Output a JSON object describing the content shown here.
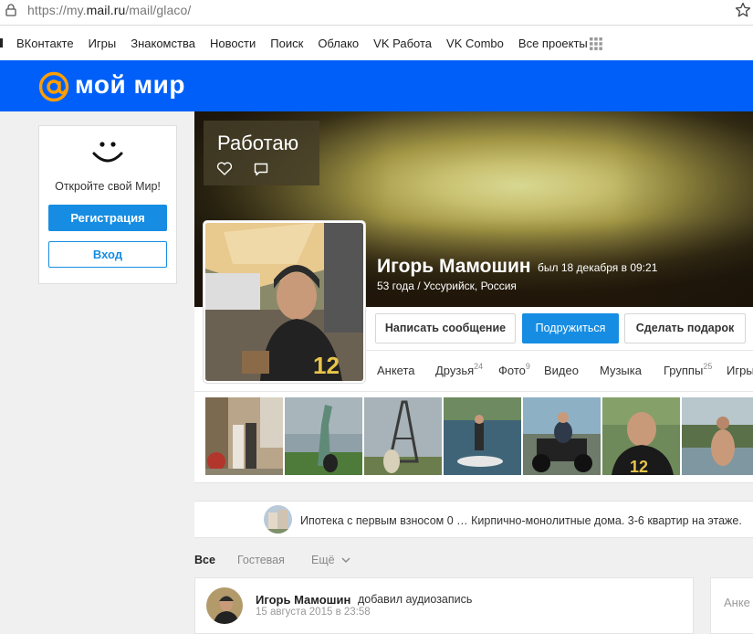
{
  "browser": {
    "url_prefix": "https://my.",
    "url_domain": "mail.ru",
    "url_path": "/mail/glaco/"
  },
  "portal_nav": {
    "items": [
      "ВКонтакте",
      "Игры",
      "Знакомства",
      "Новости",
      "Поиск",
      "Облако",
      "VK Работа",
      "VK Combo",
      "Все проекты"
    ]
  },
  "brand": {
    "title": "мой мир",
    "color": "#005ff9"
  },
  "login_card": {
    "text": "Откройте свой Мир!",
    "register_label": "Регистрация",
    "login_label": "Вход"
  },
  "profile": {
    "status": "Работаю",
    "name": "Игорь Мамошин",
    "last_seen": "был 18 декабря в 09:21",
    "meta": "53 года / Уссурийск, Россия",
    "buttons": {
      "message": "Написать сообщение",
      "friend": "Подружиться",
      "gift": "Сделать подарок"
    },
    "tabs": [
      {
        "label": "Анкета",
        "count": ""
      },
      {
        "label": "Друзья",
        "count": "24"
      },
      {
        "label": "Фото",
        "count": "9"
      },
      {
        "label": "Видео",
        "count": ""
      },
      {
        "label": "Музыка",
        "count": ""
      },
      {
        "label": "Группы",
        "count": "25"
      },
      {
        "label": "Игры",
        "count": ""
      }
    ],
    "photos": [
      "street",
      "statue-of-liberty",
      "eiffel-tower",
      "jet-ski",
      "atv",
      "football-jersey",
      "lake-shore"
    ]
  },
  "ad": {
    "text": "Ипотека с первым взносом 0 … Кирпично-монолитные дома. 3-6 квартир на этаже."
  },
  "feed": {
    "tab_all": "Все",
    "tab_guest": "Гостевая",
    "tab_more": "Ещё",
    "post": {
      "author": "Игорь Мамошин",
      "action": "добавил аудиозапись",
      "date": "15 августа 2015 в 23:58"
    },
    "side_label": "Анке"
  }
}
